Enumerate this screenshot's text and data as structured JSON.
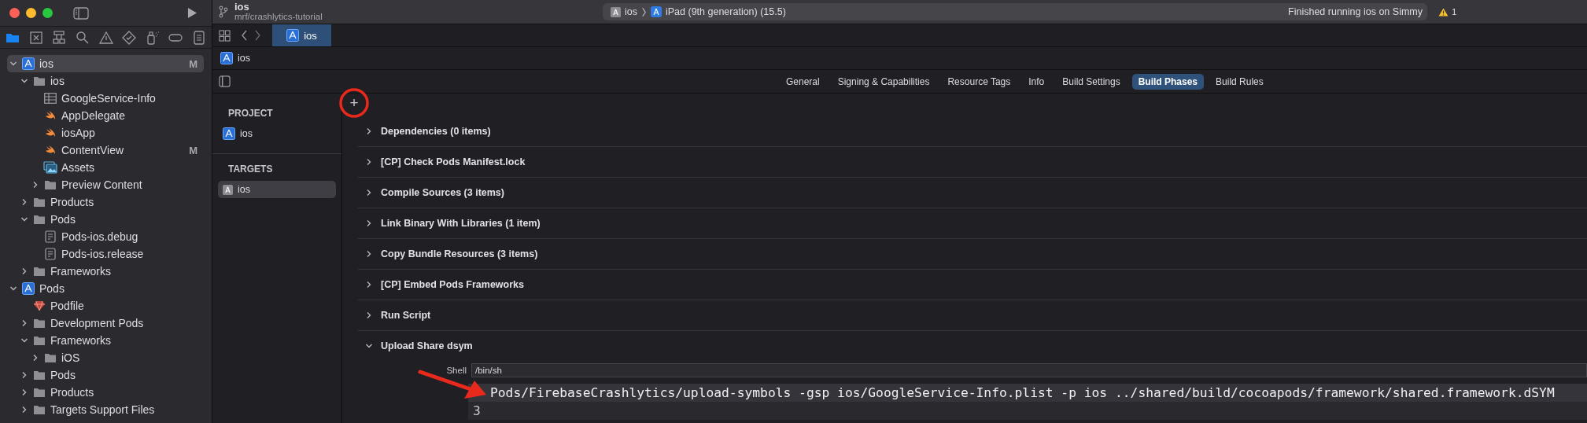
{
  "toolbar": {
    "title": "ios",
    "subtitle": "mrf/crashlytics-tutorial",
    "scheme": "ios",
    "destination": "iPad (9th generation) (15.5)",
    "status": "Finished running ios on Simmy",
    "warnings": "1"
  },
  "navigator_tabs": [
    {
      "kind": "folder",
      "selected": true
    },
    {
      "kind": "xbox",
      "selected": false
    },
    {
      "kind": "hierarchy",
      "selected": false
    },
    {
      "kind": "search",
      "selected": false
    },
    {
      "kind": "warning",
      "selected": false
    },
    {
      "kind": "diamond",
      "selected": false
    },
    {
      "kind": "spray",
      "selected": false
    },
    {
      "kind": "capsule",
      "selected": false
    },
    {
      "kind": "list",
      "selected": false
    }
  ],
  "tree": [
    {
      "label": "ios",
      "kind": "project",
      "expanded": true,
      "selected": true,
      "status": "M",
      "children": [
        {
          "label": "ios",
          "kind": "folder",
          "expanded": true,
          "selected": false,
          "children": [
            {
              "label": "GoogleService-Info",
              "kind": "plist",
              "selected": false
            },
            {
              "label": "AppDelegate",
              "kind": "swift",
              "selected": false
            },
            {
              "label": "iosApp",
              "kind": "swift",
              "selected": false
            },
            {
              "label": "ContentView",
              "kind": "swift",
              "selected": false,
              "status": "M"
            },
            {
              "label": "Assets",
              "kind": "assets",
              "selected": false
            },
            {
              "label": "Preview Content",
              "kind": "folder",
              "expanded": false,
              "selected": false
            }
          ]
        },
        {
          "label": "Products",
          "kind": "folder",
          "expanded": false,
          "selected": false
        },
        {
          "label": "Pods",
          "kind": "folder",
          "expanded": true,
          "selected": false,
          "children": [
            {
              "label": "Pods-ios.debug",
              "kind": "file",
              "selected": false
            },
            {
              "label": "Pods-ios.release",
              "kind": "file",
              "selected": false
            }
          ]
        },
        {
          "label": "Frameworks",
          "kind": "folder",
          "expanded": false,
          "selected": false
        }
      ]
    },
    {
      "label": "Pods",
      "kind": "project",
      "expanded": true,
      "selected": false,
      "children": [
        {
          "label": "Podfile",
          "kind": "ruby",
          "selected": false
        },
        {
          "label": "Development Pods",
          "kind": "folder",
          "expanded": false,
          "selected": false
        },
        {
          "label": "Frameworks",
          "kind": "folder",
          "expanded": true,
          "selected": false,
          "children": [
            {
              "label": "iOS",
              "kind": "folder",
              "expanded": false,
              "selected": false
            }
          ]
        },
        {
          "label": "Pods",
          "kind": "folder",
          "expanded": false,
          "selected": false
        },
        {
          "label": "Products",
          "kind": "folder",
          "expanded": false,
          "selected": false
        },
        {
          "label": "Targets Support Files",
          "kind": "folder",
          "expanded": false,
          "selected": false
        }
      ]
    }
  ],
  "editor_tabs": [
    {
      "label": "ios",
      "selected": true
    }
  ],
  "breadcrumb": [
    "ios"
  ],
  "settings_tabs": [
    {
      "label": "General",
      "selected": false
    },
    {
      "label": "Signing & Capabilities",
      "selected": false
    },
    {
      "label": "Resource Tags",
      "selected": false
    },
    {
      "label": "Info",
      "selected": false
    },
    {
      "label": "Build Settings",
      "selected": false
    },
    {
      "label": "Build Phases",
      "selected": true
    },
    {
      "label": "Build Rules",
      "selected": false
    }
  ],
  "project_list": [
    {
      "heading": "PROJECT",
      "items": [
        {
          "label": "ios",
          "selected": false
        }
      ]
    },
    {
      "heading": "TARGETS",
      "items": [
        {
          "label": "ios",
          "selected": true
        }
      ]
    }
  ],
  "add_button": "+",
  "phases": [
    {
      "title": "Dependencies (0 items)",
      "expanded": false
    },
    {
      "title": "[CP] Check Pods Manifest.lock",
      "expanded": false
    },
    {
      "title": "Compile Sources (3 items)",
      "expanded": false
    },
    {
      "title": "Link Binary With Libraries (1 item)",
      "expanded": false
    },
    {
      "title": "Copy Bundle Resources (3 items)",
      "expanded": false
    },
    {
      "title": "[CP] Embed Pods Frameworks",
      "expanded": false
    },
    {
      "title": "Run Script",
      "expanded": false
    },
    {
      "title": "Upload Share dsym",
      "expanded": true,
      "shell_label": "Shell",
      "shell": "/bin/sh",
      "script": [
        {
          "text": "Pods/FirebaseCrashlytics/upload-symbols -gsp ios/GoogleService-Info.plist -p ios ../shared/build/cocoapods/framework/shared.framework.dSYM",
          "selected": true
        },
        {
          "number": "3",
          "selected": false
        }
      ]
    }
  ]
}
